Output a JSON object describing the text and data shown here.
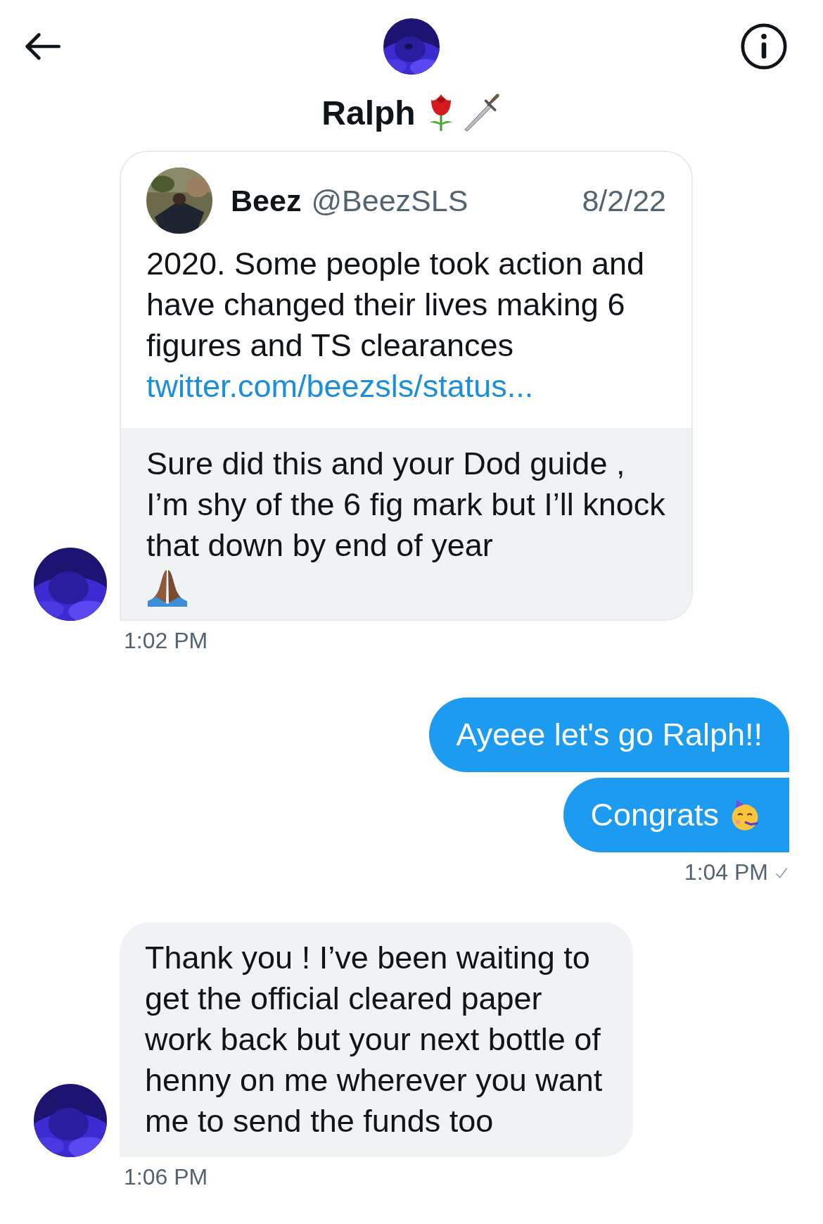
{
  "header": {
    "title": "Ralph",
    "title_icons": [
      {
        "kind": "rose"
      },
      {
        "kind": "dagger"
      }
    ]
  },
  "messages": [
    {
      "kind": "received_tweet",
      "tweet": {
        "author": "Beez",
        "handle": "@BeezSLS",
        "date": "8/2/22",
        "text": "2020. Some people took action and have changed their lives making 6 figures and TS clearances",
        "link": "twitter.com/beezsls/status..."
      },
      "text": "Sure did this and your Dod guide , I’m shy of the 6 fig mark but I’ll knock that down by end of year",
      "emoji": {
        "kind": "praying-hands"
      },
      "time": "1:02 PM"
    },
    {
      "kind": "sent",
      "bubbles": [
        {
          "text": "Ayeee let's go Ralph!!"
        },
        {
          "text": "Congrats",
          "emoji": {
            "kind": "party-face"
          }
        }
      ],
      "time": "1:04 PM",
      "read": true
    },
    {
      "kind": "received",
      "bubbles": [
        {
          "text": "Thank you ! I’ve been waiting to get the official cleared paper work back but your next bottle of henny on me  wherever you want me to send the funds too"
        }
      ],
      "time": "1:06 PM"
    }
  ]
}
